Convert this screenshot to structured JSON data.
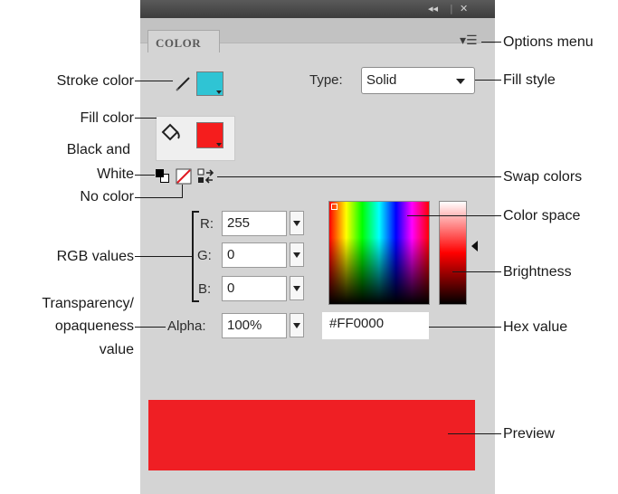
{
  "panel": {
    "tab_label": "COLOR",
    "title_controls": "◂◂ | ✕",
    "menu_icon": "options-menu-icon",
    "type_label": "Type:",
    "type_value": "Solid",
    "rgb": {
      "r_label": "R:",
      "r_value": "255",
      "g_label": "G:",
      "g_value": "0",
      "b_label": "B:",
      "b_value": "0"
    },
    "alpha_label": "Alpha:",
    "alpha_value": "100%",
    "hex_value": "#FF0000",
    "stroke_color": "#2fc4d4",
    "fill_color": "#f51d1d",
    "preview_color": "#ef1f24"
  },
  "callouts": {
    "options_menu": "Options menu",
    "fill_style": "Fill style",
    "stroke_color": "Stroke color",
    "fill_color": "Fill color",
    "black_white_1": "Black and",
    "black_white_2": "White",
    "no_color": "No color",
    "swap_colors": "Swap colors",
    "color_space": "Color space",
    "rgb_values": "RGB values",
    "brightness": "Brightness",
    "transparency_1": "Transparency/",
    "transparency_2": "opaqueness",
    "transparency_3": "value",
    "hex_value": "Hex value",
    "preview": "Preview"
  }
}
